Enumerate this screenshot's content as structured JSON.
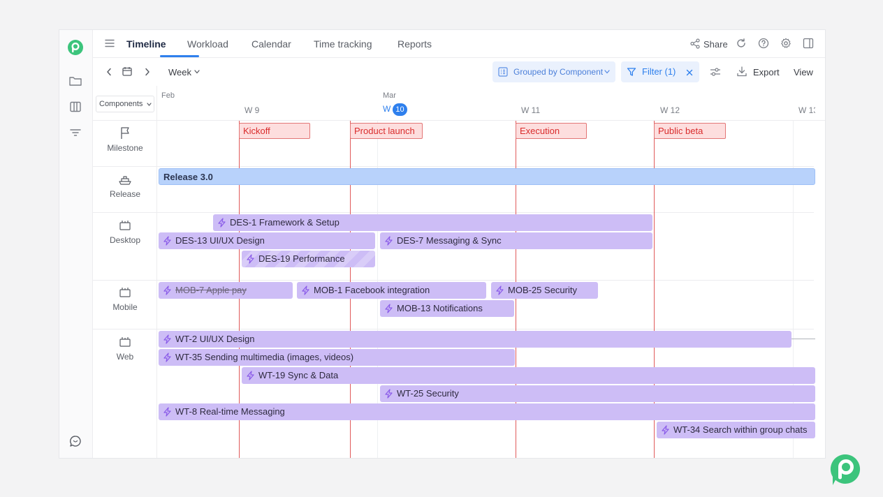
{
  "nav": {
    "tabs": [
      {
        "label": "Timeline",
        "active": true
      },
      {
        "label": "Workload"
      },
      {
        "label": "Calendar"
      },
      {
        "label": "Time tracking"
      },
      {
        "label": "Reports"
      }
    ],
    "share_label": "Share"
  },
  "toolbar": {
    "scale_label": "Week",
    "group_label": "Grouped by Component",
    "filter_label": "Filter (1)",
    "export_label": "Export",
    "view_label": "View"
  },
  "header": {
    "component_select": "Components",
    "months": [
      "Feb",
      "Mar"
    ],
    "weeks": [
      {
        "label": "W 9"
      },
      {
        "label": "W",
        "badge": "10",
        "current": true
      },
      {
        "label": "W 11"
      },
      {
        "label": "W 12"
      },
      {
        "label": "W 13"
      }
    ]
  },
  "rows": [
    "Milestone",
    "Release",
    "Desktop",
    "Mobile",
    "Web"
  ],
  "milestones": [
    "Kickoff",
    "Product launch",
    "Execution",
    "Public beta"
  ],
  "release": "Release 3.0",
  "tasks": {
    "desktop": [
      {
        "id": "DES-1",
        "title": "Framework & Setup"
      },
      {
        "id": "DES-13",
        "title": "UI/UX Design"
      },
      {
        "id": "DES-7",
        "title": "Messaging & Sync"
      },
      {
        "id": "DES-19",
        "title": "Performance"
      }
    ],
    "mobile": [
      {
        "id": "MOB-7",
        "title": "Apple pay",
        "done": true
      },
      {
        "id": "MOB-1",
        "title": "Facebook integration"
      },
      {
        "id": "MOB-25",
        "title": "Security"
      },
      {
        "id": "MOB-13",
        "title": "Notifications"
      }
    ],
    "web": [
      {
        "id": "WT-2",
        "title": "UI/UX Design"
      },
      {
        "id": "WT-35",
        "title": "Sending multimedia (images, videos)"
      },
      {
        "id": "WT-19",
        "title": "Sync & Data"
      },
      {
        "id": "WT-25",
        "title": "Security"
      },
      {
        "id": "WT-8",
        "title": "Real-time Messaging"
      },
      {
        "id": "WT-34",
        "title": "Search within group chats"
      }
    ]
  },
  "colors": {
    "accent": "#2f80ed",
    "milestone": "#e05a5a",
    "release": "#b8d2fb",
    "task": "#cdbdf6",
    "brand": "#3cc47c"
  }
}
